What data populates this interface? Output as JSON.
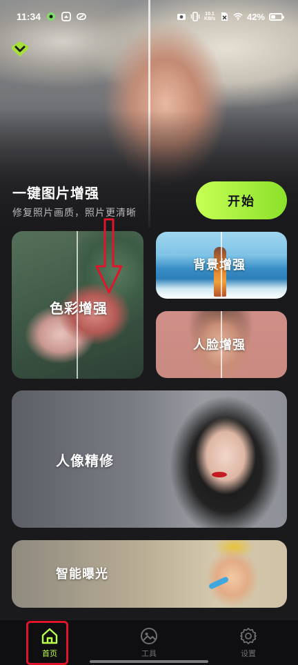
{
  "status_bar": {
    "time": "11:34",
    "net_speed_value": "10.1",
    "net_speed_unit": "KB/s",
    "battery_percent": "42%",
    "battery_level": 0.42,
    "icons": [
      "app-notification-icon",
      "gallery-icon",
      "link-icon",
      "camera-icon",
      "vibrate-icon",
      "sim-off-icon",
      "wifi-icon",
      "battery-icon"
    ]
  },
  "hero": {
    "title": "一键图片增强",
    "subtitle": "修复照片画质，照片更清晰",
    "start_button": "开始",
    "collapse_icon": "chevron-down-icon"
  },
  "cards": {
    "color_enhance": "色彩增强",
    "background_enhance": "背景增强",
    "face_enhance": "人脸增强",
    "portrait_retouch": "人像精修",
    "smart_exposure": "智能曝光"
  },
  "bottom_nav": {
    "home": "首页",
    "tools": "工具",
    "settings": "设置",
    "active": "home"
  },
  "colors": {
    "accent": "#b9ff4a",
    "start_button_gradient": [
      "#c6ff55",
      "#8be12a"
    ],
    "annotation": "#e0142a",
    "background": "#1a1a1d"
  }
}
